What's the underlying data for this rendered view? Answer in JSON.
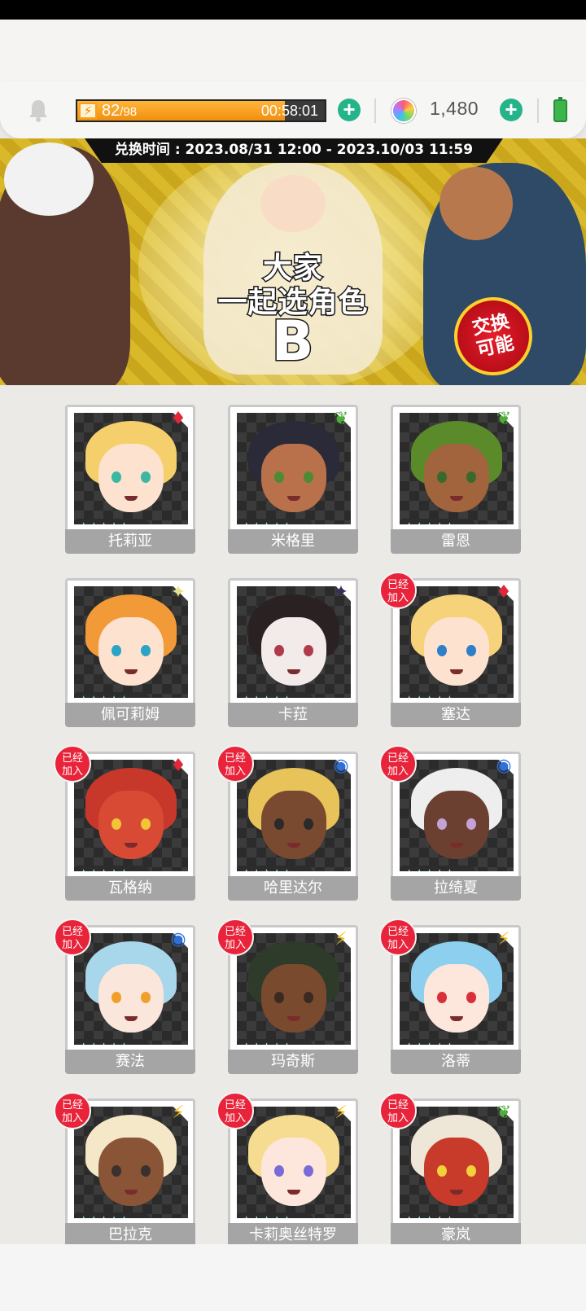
{
  "hud": {
    "stamina_current": "82",
    "stamina_max": "/98",
    "stamina_level": 0.84,
    "stamina_timer": "00:58:01",
    "gem_count": "1,480"
  },
  "banner": {
    "exchange_period": "兑换时间 : 2023.08/31 12:00 - 2023.10/03 11:59",
    "logo_line1": "大家",
    "logo_line2": "一起选角色",
    "logo_letter": "B",
    "badge": "交换可能"
  },
  "joined_label": "已经加入",
  "stars_text": "★★★★★",
  "characters": [
    {
      "name": "托莉亚",
      "element": "flame",
      "joined": false,
      "hair": "#f5cf6b",
      "skin": "#fde2cf",
      "eye": "#3ab8a2"
    },
    {
      "name": "米格里",
      "element": "wind",
      "joined": false,
      "hair": "#2a2a38",
      "skin": "#b8714a",
      "eye": "#4e8a34"
    },
    {
      "name": "雷恩",
      "element": "wind",
      "joined": false,
      "hair": "#5a8a2a",
      "skin": "#a2643c",
      "eye": "#3a6a2a"
    },
    {
      "name": "佩可莉姆",
      "element": "light",
      "joined": false,
      "hair": "#f39a38",
      "skin": "#fde2cf",
      "eye": "#2aa4c6"
    },
    {
      "name": "卡菈",
      "element": "shadow",
      "joined": false,
      "hair": "#2a2222",
      "skin": "#f3eaea",
      "eye": "#b13a4a"
    },
    {
      "name": "塞达",
      "element": "flame",
      "joined": true,
      "hair": "#f6d27a",
      "skin": "#fde2cf",
      "eye": "#2e7fc8"
    },
    {
      "name": "瓦格纳",
      "element": "flame",
      "joined": true,
      "hair": "#c8382a",
      "skin": "#d94a34",
      "eye": "#f2c438"
    },
    {
      "name": "哈里达尔",
      "element": "water",
      "joined": true,
      "hair": "#e8c35a",
      "skin": "#7a4a30",
      "eye": "#2a2a2a"
    },
    {
      "name": "拉绮夏",
      "element": "water",
      "joined": true,
      "hair": "#eeeeee",
      "skin": "#6b4030",
      "eye": "#c4a2d8"
    },
    {
      "name": "赛法",
      "element": "water",
      "joined": true,
      "hair": "#a8d6ea",
      "skin": "#fbe6dc",
      "eye": "#f0a02a"
    },
    {
      "name": "玛奇斯",
      "element": "lightning",
      "joined": true,
      "hair": "#2e3a2a",
      "skin": "#7a4a2e",
      "eye": "#3a2a20"
    },
    {
      "name": "洛蒂",
      "element": "lightning",
      "joined": true,
      "hair": "#8ccfee",
      "skin": "#fde6dc",
      "eye": "#d83038"
    },
    {
      "name": "巴拉克",
      "element": "lightning",
      "joined": true,
      "hair": "#f4e8c8",
      "skin": "#8a5436",
      "eye": "#3a3030"
    },
    {
      "name": "卡莉奥丝特罗",
      "element": "lightning",
      "joined": true,
      "hair": "#f6dc90",
      "skin": "#fde6dc",
      "eye": "#7a6ad8"
    },
    {
      "name": "豪岚",
      "element": "wind",
      "joined": true,
      "hair": "#eee6d6",
      "skin": "#c83a2a",
      "eye": "#f2d23a"
    }
  ],
  "element_icons": {
    "flame": "♦",
    "wind": "❦",
    "light": "✦",
    "shadow": "✦",
    "water": "◉",
    "lightning": "⚡"
  },
  "element_colors": {
    "flame": "#e0283a",
    "wind": "#4caf3a",
    "light": "#e6e28a",
    "shadow": "#3a2a5a",
    "water": "#2e6fd8",
    "lightning": "#f2c21a"
  }
}
